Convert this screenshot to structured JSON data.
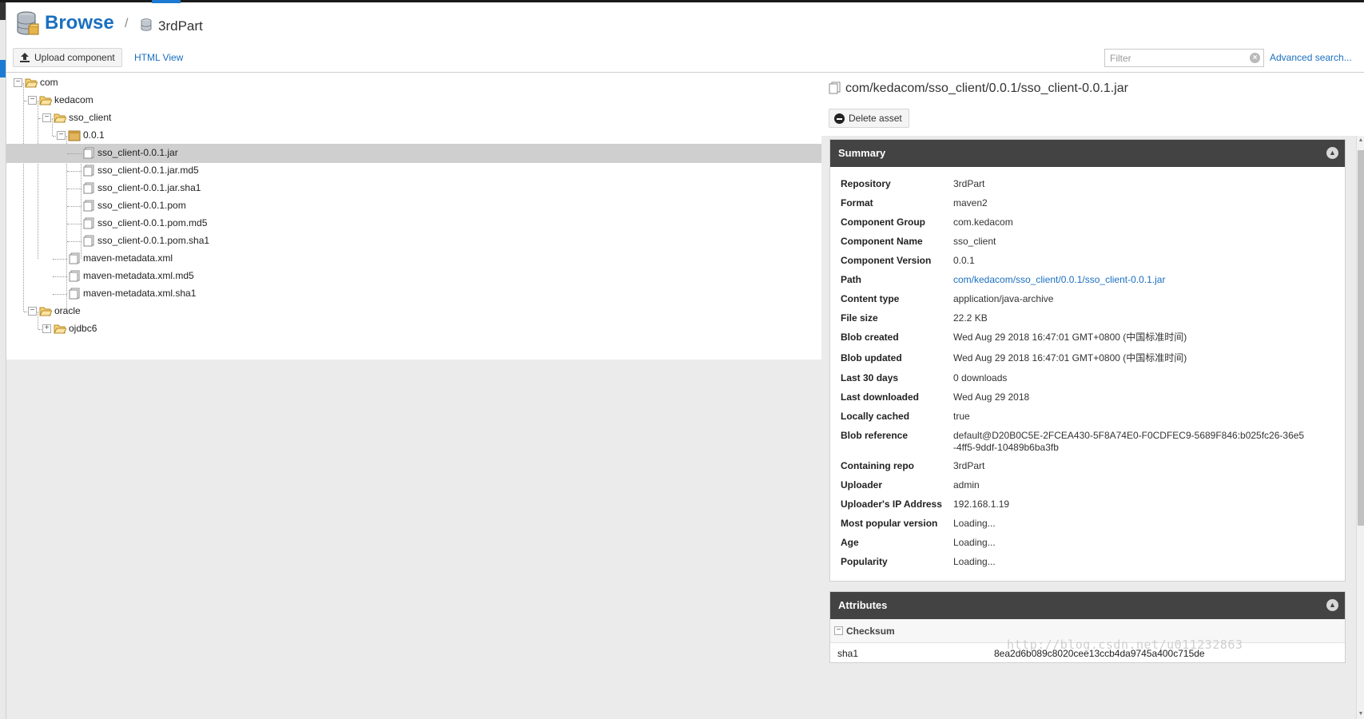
{
  "header": {
    "title": "Browse",
    "separator": "/",
    "repository": "3rdPart"
  },
  "toolbar": {
    "upload_label": "Upload component",
    "html_view_label": "HTML View",
    "filter_placeholder": "Filter",
    "advanced_search_label": "Advanced search..."
  },
  "tree": {
    "com": "com",
    "kedacom": "kedacom",
    "sso_client": "sso_client",
    "version": "0.0.1",
    "f_jar": "sso_client-0.0.1.jar",
    "f_jar_md5": "sso_client-0.0.1.jar.md5",
    "f_jar_sha1": "sso_client-0.0.1.jar.sha1",
    "f_pom": "sso_client-0.0.1.pom",
    "f_pom_md5": "sso_client-0.0.1.pom.md5",
    "f_pom_sha1": "sso_client-0.0.1.pom.sha1",
    "meta": "maven-metadata.xml",
    "meta_md5": "maven-metadata.xml.md5",
    "meta_sha1": "maven-metadata.xml.sha1",
    "oracle": "oracle",
    "ojdbc6": "ojdbc6",
    "selected": "sso_client-0.0.1.jar"
  },
  "detail": {
    "asset_path": "com/kedacom/sso_client/0.0.1/sso_client-0.0.1.jar",
    "delete_label": "Delete asset"
  },
  "summary": {
    "title": "Summary",
    "rows": [
      {
        "key": "Repository",
        "value": "3rdPart"
      },
      {
        "key": "Format",
        "value": "maven2"
      },
      {
        "key": "Component Group",
        "value": "com.kedacom"
      },
      {
        "key": "Component Name",
        "value": "sso_client"
      },
      {
        "key": "Component Version",
        "value": "0.0.1"
      },
      {
        "key": "Path",
        "value": "com/kedacom/sso_client/0.0.1/sso_client-0.0.1.jar"
      },
      {
        "key": "Content type",
        "value": "application/java-archive"
      },
      {
        "key": "File size",
        "value": "22.2 KB"
      },
      {
        "key": "Blob created",
        "value": "Wed Aug 29 2018 16:47:01 GMT+0800 (中国标准时间)"
      },
      {
        "key": "Blob updated",
        "value": "Wed Aug 29 2018 16:47:01 GMT+0800 (中国标准时间)"
      },
      {
        "key": "Last 30 days",
        "value": "0 downloads"
      },
      {
        "key": "Last downloaded",
        "value": "Wed Aug 29 2018"
      },
      {
        "key": "Locally cached",
        "value": "true"
      },
      {
        "key": "Blob reference",
        "value": "default@D20B0C5E-2FCEA430-5F8A74E0-F0CDFEC9-5689F846:b025fc26-36e5-4ff5-9ddf-10489b6ba3fb"
      },
      {
        "key": "Containing repo",
        "value": "3rdPart"
      },
      {
        "key": "Uploader",
        "value": "admin"
      },
      {
        "key": "Uploader's IP Address",
        "value": "192.168.1.19"
      },
      {
        "key": "Most popular version",
        "value": "Loading..."
      },
      {
        "key": "Age",
        "value": "Loading..."
      },
      {
        "key": "Popularity",
        "value": "Loading..."
      }
    ]
  },
  "attributes": {
    "title": "Attributes",
    "group": "Checksum",
    "rows": [
      {
        "key": "sha1",
        "value": "8ea2d6b089c8020cee13ccb4da9745a400c715de"
      }
    ]
  },
  "watermark": "http://blog.csdn.net/u011232863",
  "colors": {
    "accent": "#1a6fc0",
    "panel_header": "#434343",
    "selected_row": "#cfcfcf"
  }
}
